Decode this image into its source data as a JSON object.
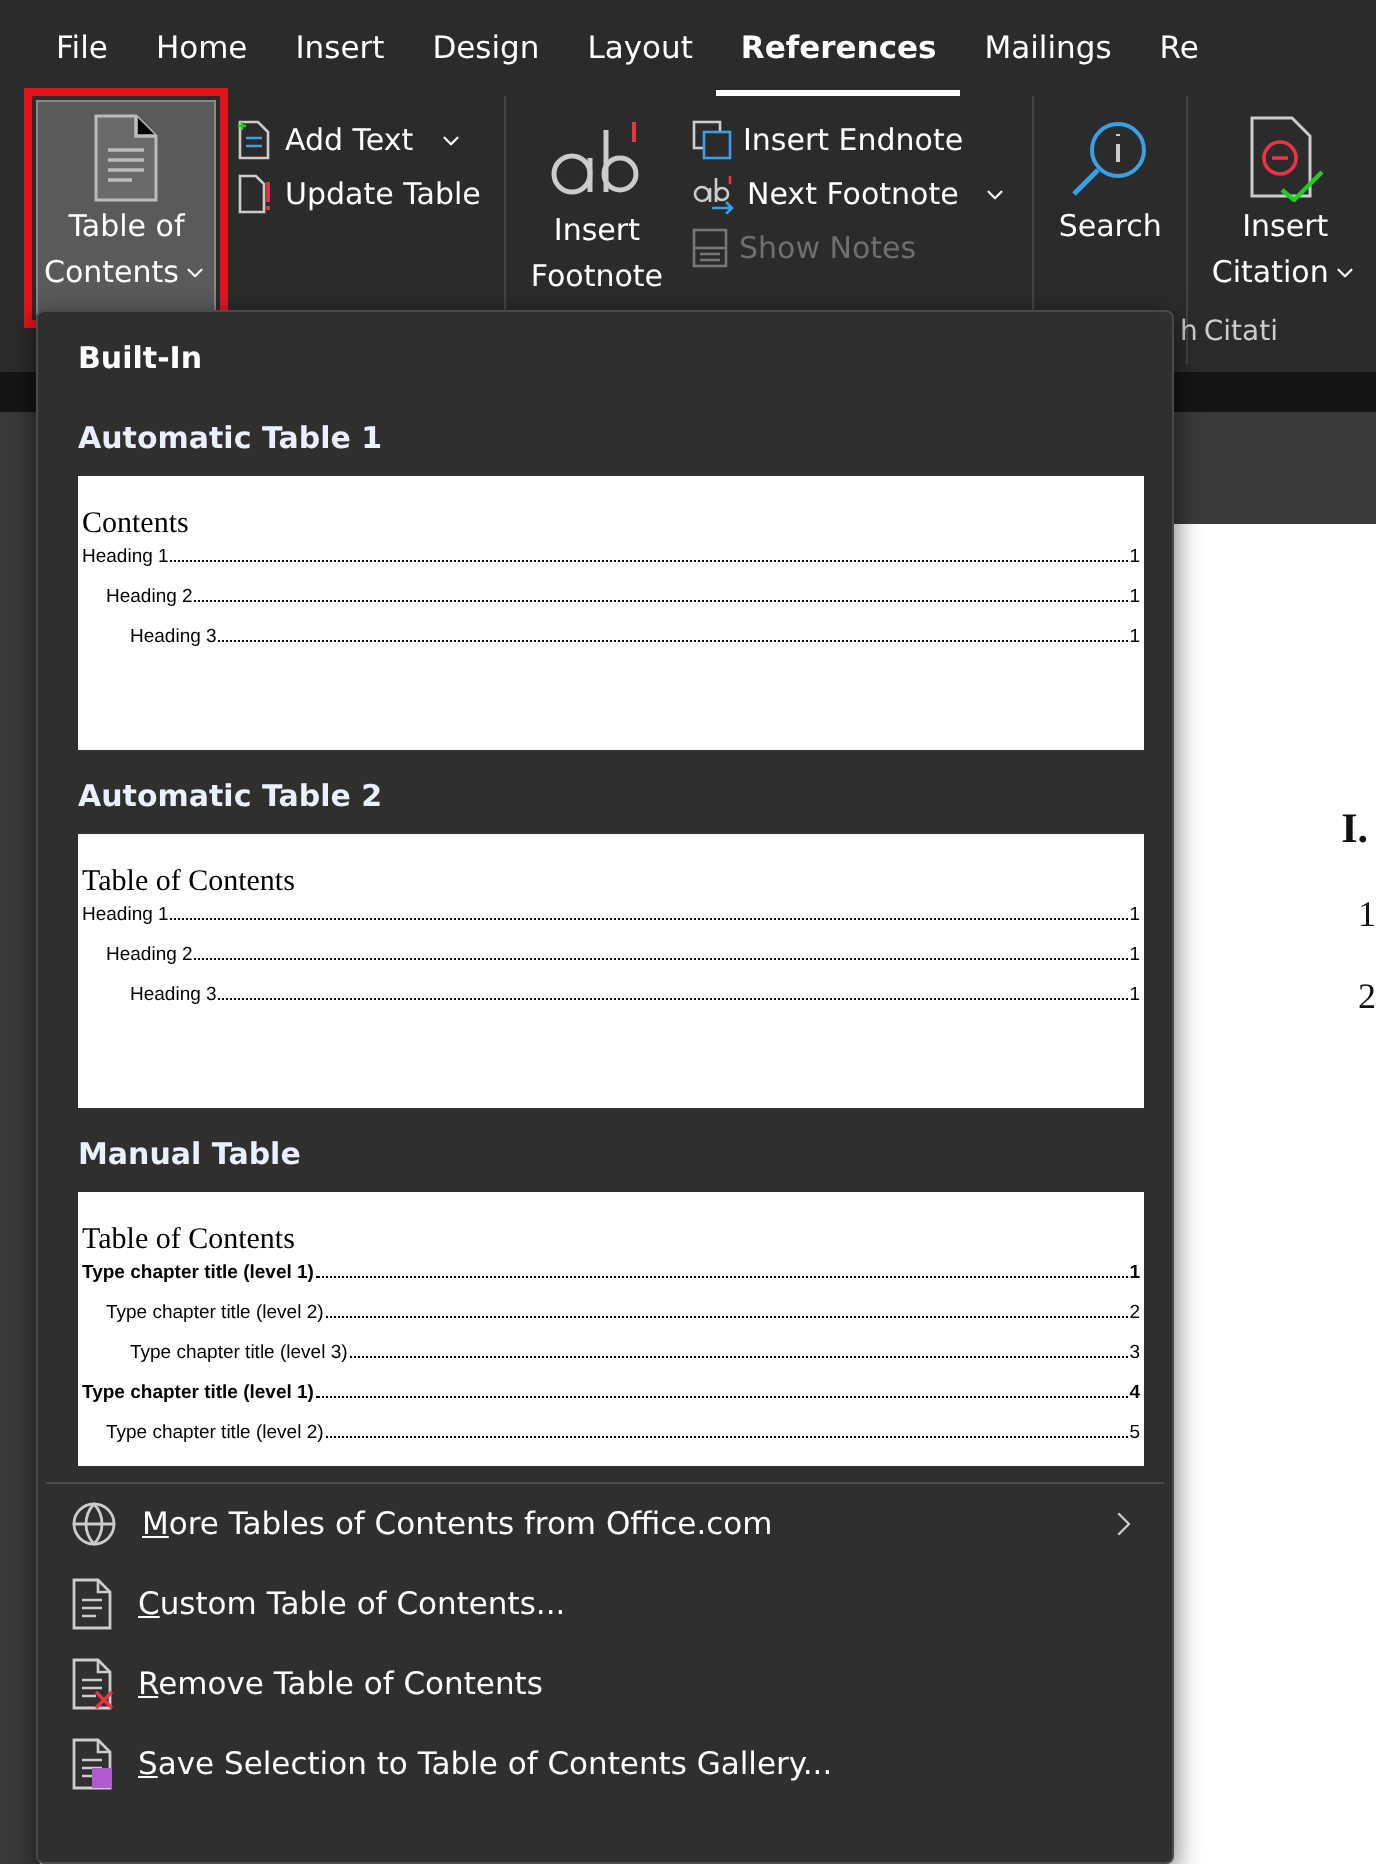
{
  "tabs": [
    {
      "label": "File",
      "selected": false
    },
    {
      "label": "Home",
      "selected": false
    },
    {
      "label": "Insert",
      "selected": false
    },
    {
      "label": "Design",
      "selected": false
    },
    {
      "label": "Layout",
      "selected": false
    },
    {
      "label": "References",
      "selected": true
    },
    {
      "label": "Mailings",
      "selected": false
    },
    {
      "label": "Re",
      "selected": false
    }
  ],
  "ribbon": {
    "groups": [
      {
        "large": [
          {
            "kind": "toc",
            "lines": [
              "Table of",
              "Contents"
            ],
            "dropdown": true,
            "highlighted": true
          }
        ],
        "small": [
          {
            "kind": "addtext",
            "label": "Add Text",
            "dropdown": true,
            "disabled": false
          },
          {
            "kind": "update",
            "label": "Update Table",
            "dropdown": false,
            "disabled": false
          }
        ]
      },
      {
        "large": [
          {
            "kind": "footnote",
            "lines": [
              "Insert",
              "Footnote"
            ],
            "dropdown": false,
            "highlighted": false
          }
        ],
        "small": [
          {
            "kind": "endnote",
            "label": "Insert Endnote",
            "dropdown": false,
            "disabled": false
          },
          {
            "kind": "nextnote",
            "label": "Next Footnote",
            "dropdown": true,
            "disabled": false
          },
          {
            "kind": "shownotes",
            "label": "Show Notes",
            "dropdown": false,
            "disabled": true
          }
        ]
      },
      {
        "label": "h",
        "large": [
          {
            "kind": "search",
            "lines": [
              "Search"
            ],
            "dropdown": false,
            "highlighted": false
          }
        ]
      },
      {
        "label": "Citati",
        "large": [
          {
            "kind": "citation",
            "lines": [
              "Insert",
              "Citation"
            ],
            "dropdown": true,
            "highlighted": false
          }
        ]
      }
    ]
  },
  "document": {
    "lines": [
      {
        "kind": "heading",
        "text": "I."
      },
      {
        "kind": "item",
        "text": "1"
      },
      {
        "kind": "item",
        "text": "2"
      }
    ]
  },
  "menu": {
    "section": "Built-In",
    "galleries": [
      {
        "title": "Automatic Table 1",
        "preview_title": "Contents",
        "entries": [
          {
            "text": "Heading 1",
            "page": "1",
            "bold": false,
            "children": [
              {
                "text": "Heading 2",
                "page": "1",
                "bold": false,
                "children": [
                  {
                    "text": "Heading 3",
                    "page": "1",
                    "bold": false
                  }
                ]
              }
            ]
          }
        ]
      },
      {
        "title": "Automatic Table 2",
        "preview_title": "Table of Contents",
        "entries": [
          {
            "text": "Heading 1",
            "page": "1",
            "bold": false,
            "children": [
              {
                "text": "Heading 2",
                "page": "1",
                "bold": false,
                "children": [
                  {
                    "text": "Heading 3",
                    "page": "1",
                    "bold": false
                  }
                ]
              }
            ]
          }
        ]
      },
      {
        "title": "Manual Table",
        "preview_title": "Table of Contents",
        "entries": [
          {
            "text": "Type chapter title (level 1)",
            "page": "1",
            "bold": true,
            "children": [
              {
                "text": "Type chapter title (level 2)",
                "page": "2",
                "bold": false,
                "children": [
                  {
                    "text": "Type chapter title (level 3)",
                    "page": "3",
                    "bold": false
                  }
                ]
              }
            ]
          },
          {
            "text": "Type chapter title (level 1)",
            "page": "4",
            "bold": true,
            "children": [
              {
                "text": "Type chapter title (level 2)",
                "page": "5",
                "bold": false
              }
            ]
          }
        ]
      }
    ],
    "commands": [
      {
        "kind": "globe",
        "label": "More Tables of Contents from Office.com",
        "access_first": true,
        "submenu": true
      },
      {
        "kind": "custom",
        "label": "Custom Table of Contents...",
        "access_first": true,
        "submenu": false
      },
      {
        "kind": "remove",
        "label": "Remove Table of Contents",
        "access_first": true,
        "submenu": false
      },
      {
        "kind": "save",
        "label": "Save Selection to Table of Contents Gallery...",
        "access_first": true,
        "submenu": false
      }
    ]
  }
}
